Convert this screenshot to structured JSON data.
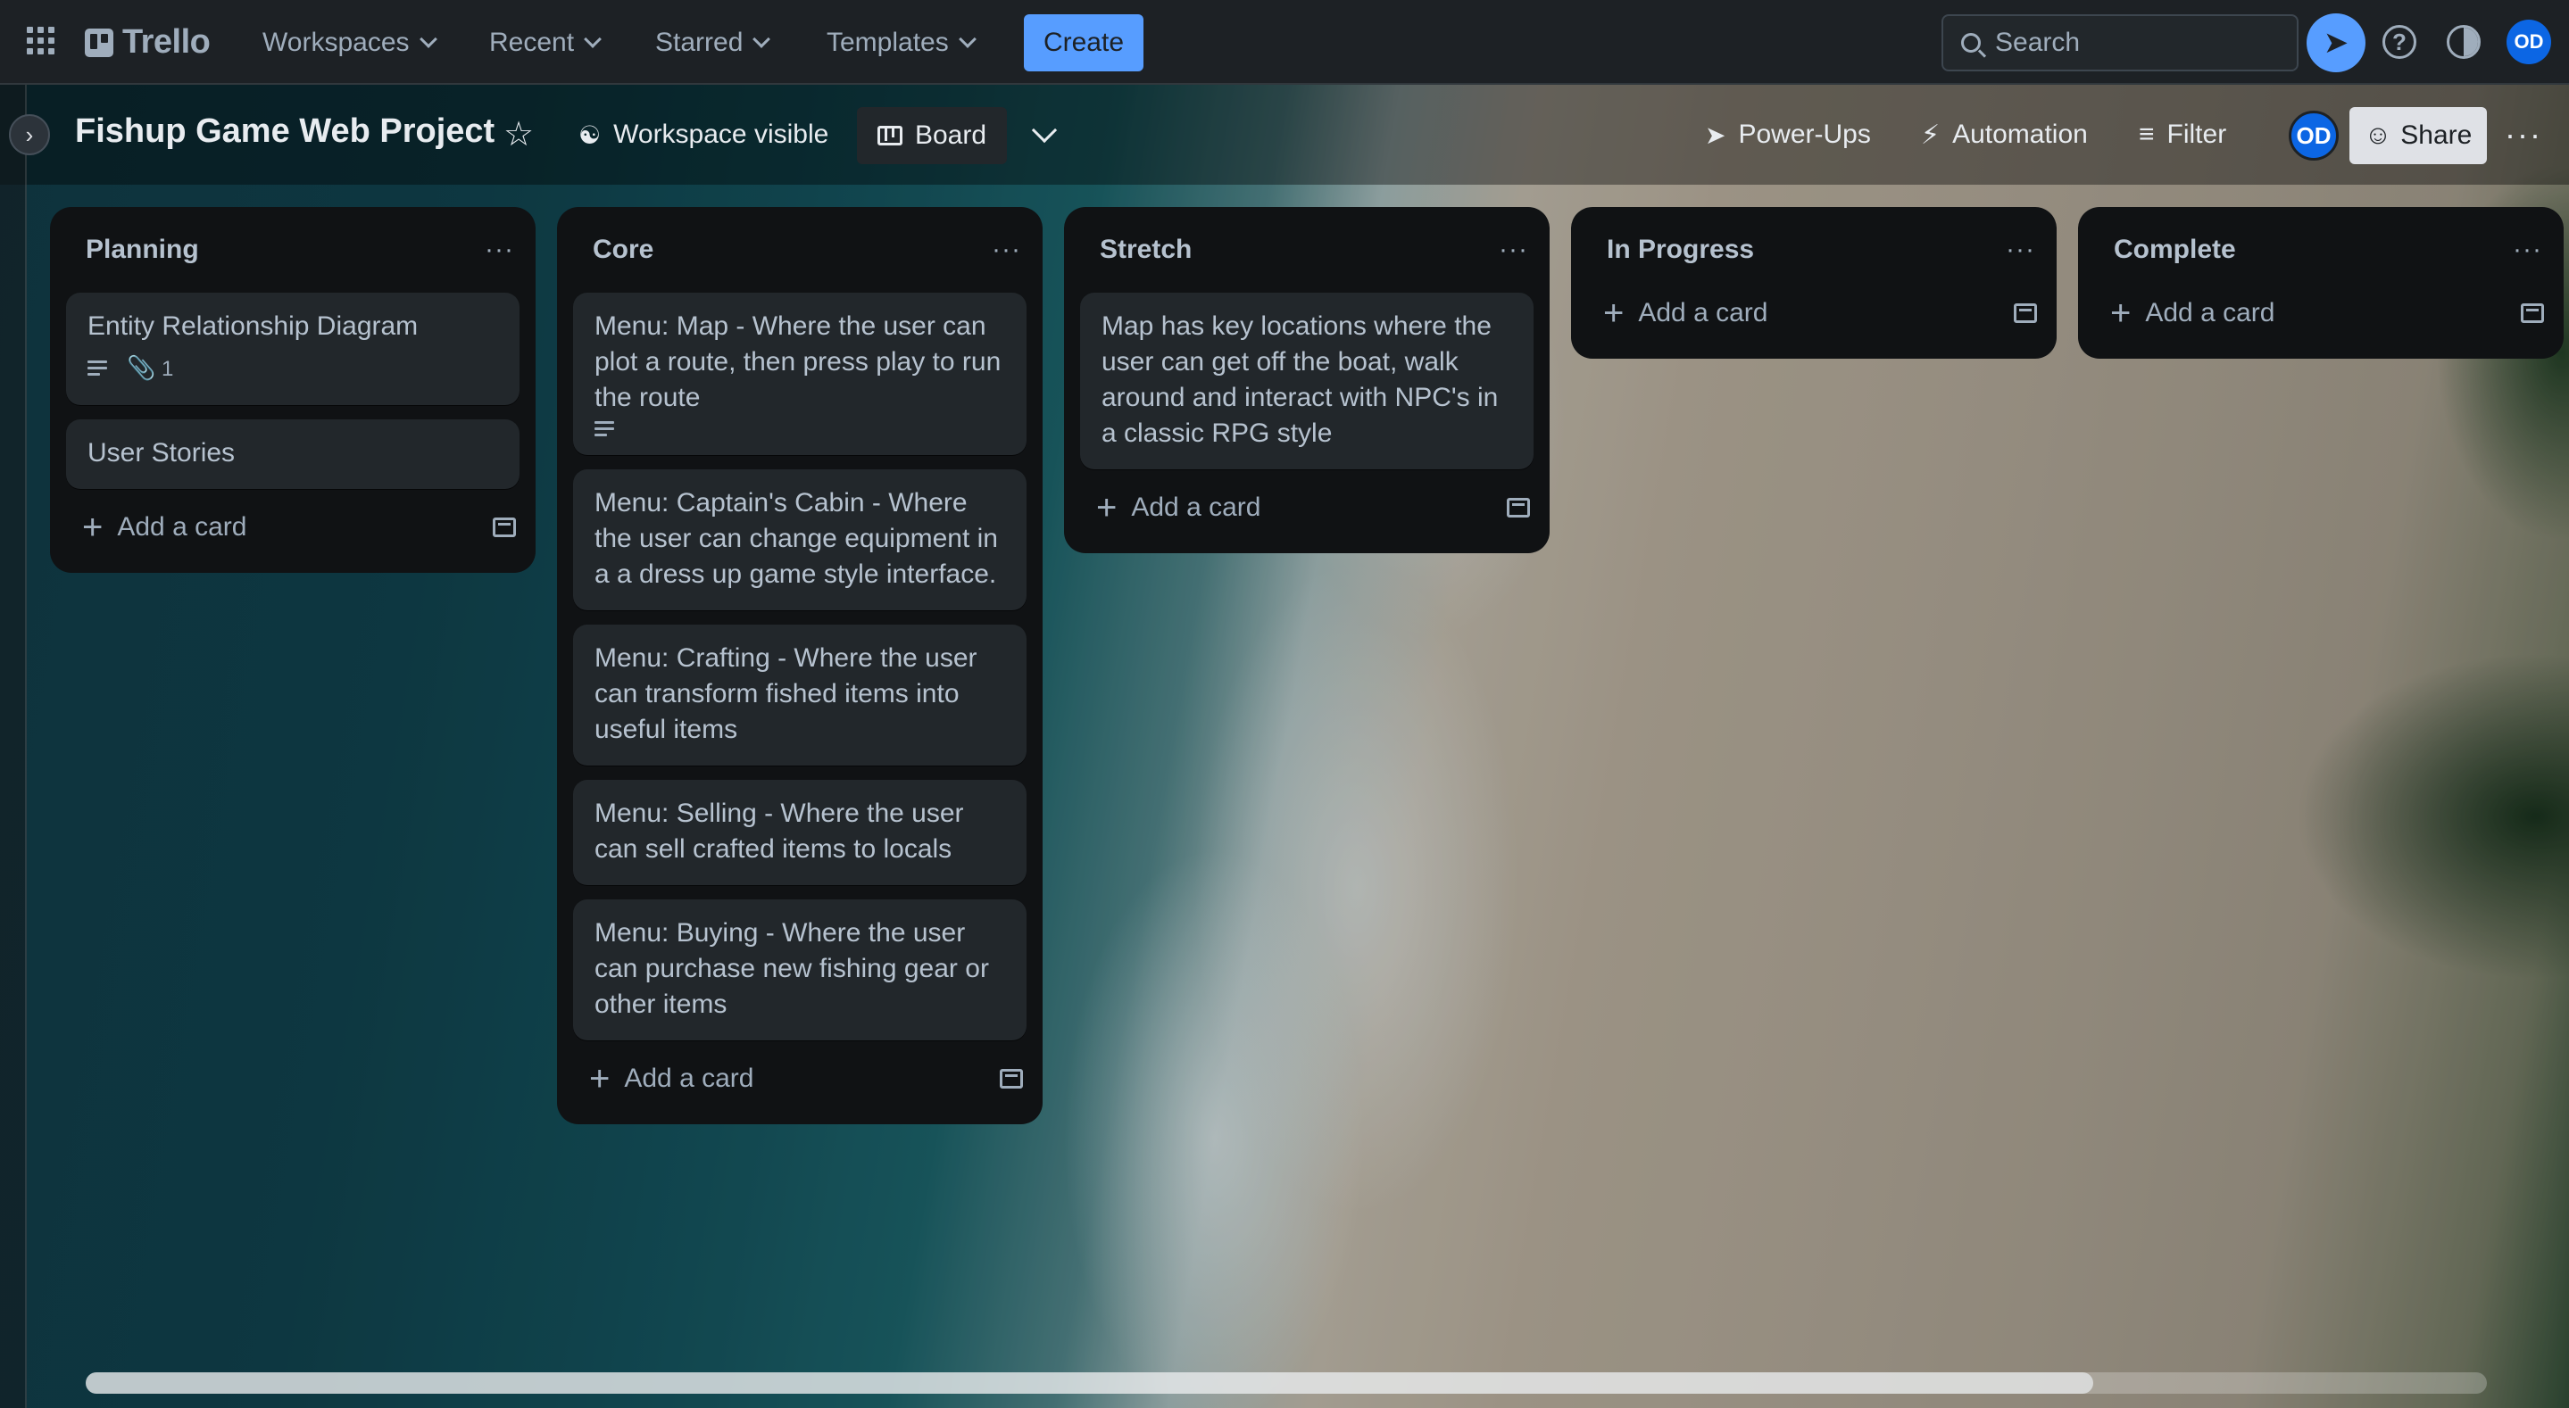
{
  "nav": {
    "logo": "Trello",
    "workspaces": "Workspaces",
    "recent": "Recent",
    "starred": "Starred",
    "templates": "Templates",
    "create": "Create",
    "search_placeholder": "Search",
    "avatar_initials": "OD",
    "help": "?"
  },
  "board": {
    "title": "Fishup Game Web Project",
    "visibility": "Workspace visible",
    "view": "Board",
    "power_ups": "Power-Ups",
    "automation": "Automation",
    "filter": "Filter",
    "member_initials": "OD",
    "share": "Share"
  },
  "lists": [
    {
      "title": "Planning",
      "cards": [
        {
          "text": "Entity Relationship Diagram",
          "has_description": true,
          "attachments": "1"
        },
        {
          "text": "User Stories"
        }
      ],
      "add_card": "Add a card"
    },
    {
      "title": "Core",
      "cards": [
        {
          "text": "Menu: Map - Where the user can plot a route, then press play to run the route",
          "has_description": true
        },
        {
          "text": "Menu: Captain's Cabin - Where the user can change equipment in a a dress up game style interface."
        },
        {
          "text": "Menu: Crafting - Where the user can transform fished items into useful items"
        },
        {
          "text": "Menu: Selling - Where the user can sell crafted items to locals"
        },
        {
          "text": "Menu: Buying - Where the user can purchase new fishing gear or other items"
        }
      ],
      "add_card": "Add a card"
    },
    {
      "title": "Stretch",
      "cards": [
        {
          "text": "Map has key locations where the user can get off the boat, walk around and interact with NPC's in a classic RPG style"
        }
      ],
      "add_card": "Add a card"
    },
    {
      "title": "In Progress",
      "cards": [],
      "add_card": "Add a card"
    },
    {
      "title": "Complete",
      "cards": [],
      "add_card": "Add a card"
    }
  ],
  "scroll": {
    "visible_fraction": 0.836
  },
  "colors": {
    "accent": "#579dff",
    "nav_bg": "#1d2125",
    "list_bg": "#101214",
    "card_bg": "#22272b",
    "avatar": "#0c66e4"
  }
}
